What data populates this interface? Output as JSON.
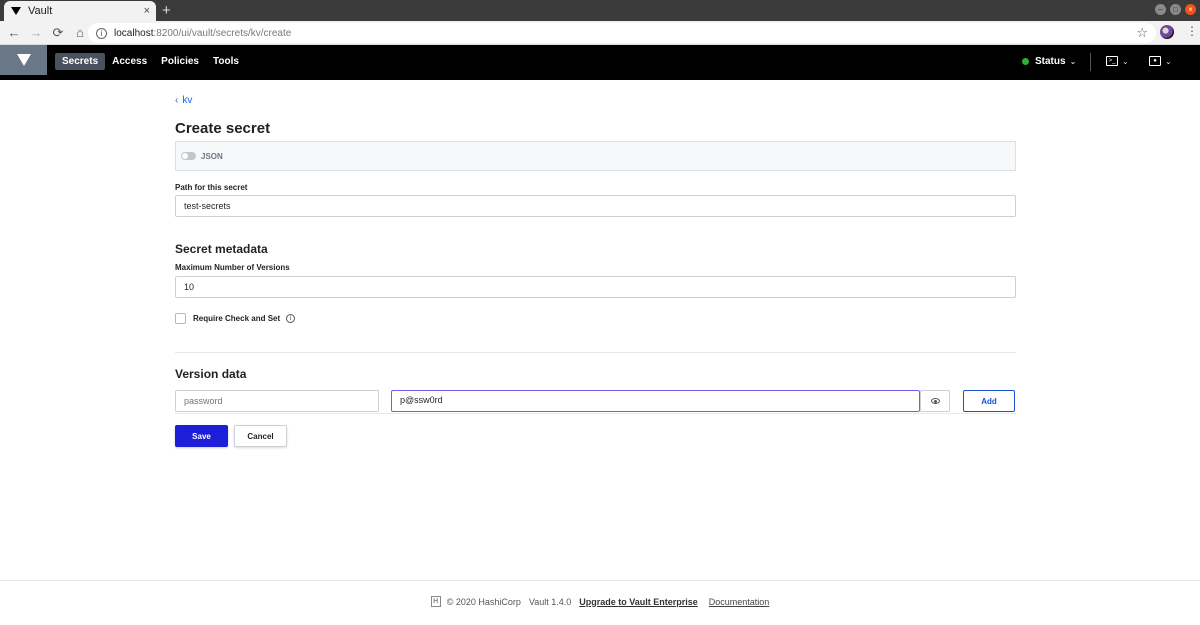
{
  "browser": {
    "tab_title": "Vault",
    "tab_close": "×",
    "new_tab": "+",
    "url_host": "localhost",
    "url_path": ":8200/ui/vault/secrets/kv/create"
  },
  "nav": {
    "links": [
      "Secrets",
      "Access",
      "Policies",
      "Tools"
    ],
    "status_label": "Status"
  },
  "colors": {
    "nav_bg": "#000000",
    "primary": "#1d1ed8",
    "status_ok": "#2eb039",
    "link": "#1563ff"
  },
  "page": {
    "breadcrumb": "kv",
    "title": "Create secret",
    "json_toggle_label": "JSON",
    "path_label": "Path for this secret",
    "path_value": "test-secrets",
    "metadata_title": "Secret metadata",
    "max_versions_label": "Maximum Number of Versions",
    "max_versions_value": "10",
    "cas_label": "Require Check and Set",
    "version_data_title": "Version data",
    "key_value": "password",
    "secret_value": "p@ssw0rd",
    "add_label": "Add",
    "save_label": "Save",
    "cancel_label": "Cancel"
  },
  "footer": {
    "copyright": "© 2020 HashiCorp",
    "version": "Vault 1.4.0",
    "upgrade_link": "Upgrade to Vault Enterprise",
    "docs_link": "Documentation"
  }
}
